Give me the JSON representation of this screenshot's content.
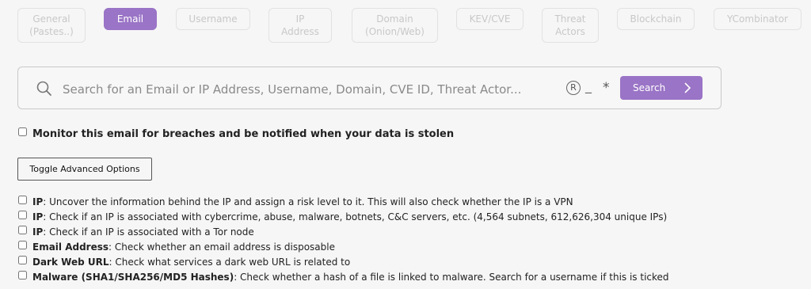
{
  "tabs": [
    {
      "label": "General (Pastes..)",
      "line1": "General",
      "line2": "(Pastes..)",
      "active": false
    },
    {
      "label": "Email",
      "line1": "Email",
      "line2": "",
      "active": true
    },
    {
      "label": "Username",
      "line1": "Username",
      "line2": "",
      "active": false
    },
    {
      "label": "IP Address",
      "line1": "IP",
      "line2": "Address",
      "active": false
    },
    {
      "label": "Domain (Onion/Web)",
      "line1": "Domain",
      "line2": "(Onion/Web)",
      "active": false
    },
    {
      "label": "KEV/CVE",
      "line1": "KEV/CVE",
      "line2": "",
      "active": false
    },
    {
      "label": "Threat Actors",
      "line1": "Threat",
      "line2": "Actors",
      "active": false
    },
    {
      "label": "Blockchain",
      "line1": "Blockchain",
      "line2": "",
      "active": false
    },
    {
      "label": "YCombinator",
      "line1": "YCombinator",
      "line2": "",
      "active": false
    }
  ],
  "search": {
    "placeholder": "Search for an Email or IP Address, Username, Domain, CVE ID, Threat Actor...",
    "value": "",
    "reg_glyph": "R",
    "underscore_glyph": "_",
    "asterisk_glyph": "*",
    "button_label": "Search"
  },
  "monitor": {
    "label": "Monitor this email for breaches and be notified when your data is stolen",
    "checked": false
  },
  "toggle_button_label": "Toggle Advanced Options",
  "options": [
    {
      "title": "IP",
      "desc": ": Uncover the information behind the IP and assign a risk level to it. This will also check whether the IP is a VPN"
    },
    {
      "title": "IP",
      "desc": ": Check if an IP is associated with cybercrime, abuse, malware, botnets, C&C servers, etc. (4,564 subnets, 612,626,304 unique IPs)"
    },
    {
      "title": "IP",
      "desc": ": Check if an IP is associated with a Tor node"
    },
    {
      "title": "Email Address",
      "desc": ": Check whether an email address is disposable"
    },
    {
      "title": "Dark Web URL",
      "desc": ": Check what services a dark web URL is related to"
    },
    {
      "title": "Malware (SHA1/SHA256/MD5 Hashes)",
      "desc": ": Check whether a hash of a file is linked to malware. Search for a username if this is ticked"
    }
  ],
  "colors": {
    "accent": "#9a74c6",
    "tab_inactive_text": "#c8c8c8",
    "background": "#f6f6f6"
  }
}
